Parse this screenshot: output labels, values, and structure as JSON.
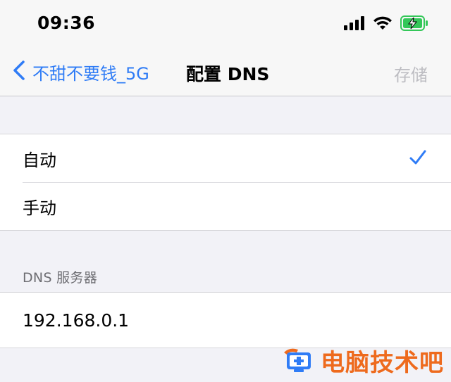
{
  "status_bar": {
    "time": "09:36",
    "icons": [
      "cellular-signal-icon",
      "wifi-icon",
      "battery-charging-icon"
    ]
  },
  "nav": {
    "back_label": "不甜不要钱_5G",
    "title": "配置 DNS",
    "action_label": "存储"
  },
  "mode_options": [
    {
      "label": "自动",
      "selected": true
    },
    {
      "label": "手动",
      "selected": false
    }
  ],
  "dns_section": {
    "header": "DNS 服务器",
    "servers": [
      "192.168.0.1"
    ]
  },
  "watermark": {
    "text": "电脑技术吧"
  },
  "colors": {
    "accent": "#2f7cf6",
    "disabled": "#bdbdc2",
    "watermark": "#ee6a1d",
    "battery": "#34c759"
  }
}
